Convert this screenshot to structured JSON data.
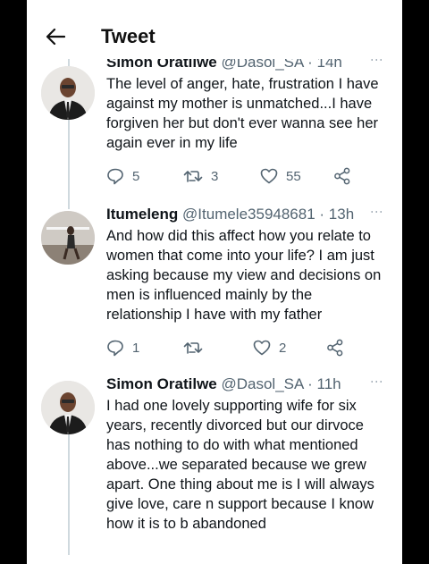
{
  "header": {
    "title": "Tweet"
  },
  "tweets": [
    {
      "name": "Simon Oratilwe",
      "handle": "@Dasol_SA",
      "time": "· 14h",
      "text": "The level of anger, hate, frustration I have against my mother is unmatched...I have forgiven her but don't ever wanna see her again ever in my life",
      "replies": "5",
      "retweets": "3",
      "likes": "55"
    },
    {
      "name": "Itumeleng",
      "handle": "@Itumele35948681",
      "time": "· 13h",
      "text": "And how did this affect how you relate to women that come into your life? I am just asking because my view and decisions on men is influenced mainly by the relationship I have with my father",
      "replies": "1",
      "retweets": "",
      "likes": "2"
    },
    {
      "name": "Simon Oratilwe",
      "handle": "@Dasol_SA",
      "time": "· 11h",
      "text": "I had one lovely supporting wife for six years, recently divorced but our dirvoce has nothing to do with what mentioned above...we separated because we grew apart. One thing about me is I will always give love, care n support because I know how it is to b abandoned"
    }
  ],
  "icons": {
    "back": "arrow-left-icon",
    "reply": "reply-icon",
    "retweet": "retweet-icon",
    "like": "heart-icon",
    "share": "share-icon",
    "more": "more-icon"
  },
  "colors": {
    "text": "#0f1419",
    "muted": "#536471",
    "thread": "#cfd9de"
  }
}
